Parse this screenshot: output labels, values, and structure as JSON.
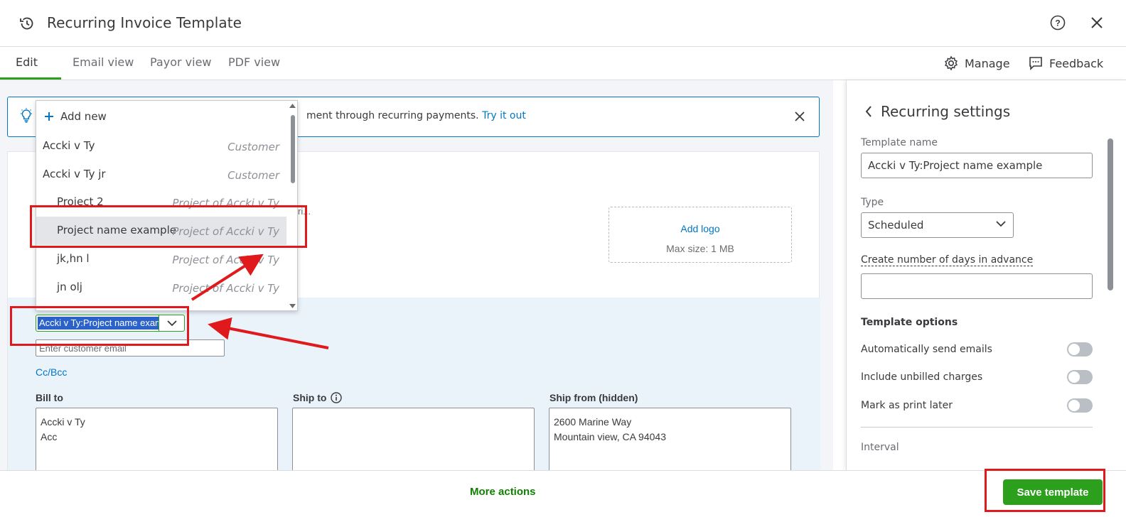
{
  "window": {
    "title": "Recurring Invoice Template"
  },
  "tabs": [
    {
      "label": "Edit",
      "active": true
    },
    {
      "label": "Email view",
      "active": false
    },
    {
      "label": "Payor view",
      "active": false
    },
    {
      "label": "PDF view",
      "active": false
    }
  ],
  "header_actions": {
    "manage": "Manage",
    "feedback": "Feedback"
  },
  "banner": {
    "text": "ment through recurring payments.",
    "link": "Try it out"
  },
  "logo": {
    "add": "Add logo",
    "max_size": "Max size: 1 MB"
  },
  "partial_text": "ri...",
  "customer": {
    "selected": "Accki v Ty:Project name example",
    "email_placeholder": "Enter customer email",
    "cc_bcc": "Cc/Bcc"
  },
  "dropdown": {
    "add_new": "Add new",
    "items": [
      {
        "name": "Accki v Ty",
        "type": "Customer",
        "indent": false,
        "selected": false
      },
      {
        "name": "Accki v Ty jr",
        "type": "Customer",
        "indent": false,
        "selected": false
      },
      {
        "name": "Project 2",
        "type": "Project of Accki v Ty",
        "indent": true,
        "selected": false
      },
      {
        "name": "Project name example",
        "type": "Project of Accki v Ty",
        "indent": true,
        "selected": true
      },
      {
        "name": "jk,hn l",
        "type": "Project of Accki v Ty",
        "indent": true,
        "selected": false
      },
      {
        "name": "jn olj",
        "type": "Project of Accki v Ty",
        "indent": true,
        "selected": false
      }
    ]
  },
  "addresses": {
    "bill_to": {
      "label": "Bill to",
      "value": "Accki v Ty\nAcc"
    },
    "ship_to": {
      "label": "Ship to",
      "value": ""
    },
    "ship_from": {
      "label": "Ship from (hidden)",
      "value": "2600 Marine Way\nMountain view, CA 94043"
    }
  },
  "recurring": {
    "title": "Recurring settings",
    "template_name_label": "Template name",
    "template_name": "Accki v Ty:Project name example",
    "type_label": "Type",
    "type_value": "Scheduled",
    "days_advance_label": "Create number of days in advance",
    "days_advance_value": "",
    "options_label": "Template options",
    "options": [
      {
        "label": "Automatically send emails",
        "on": false
      },
      {
        "label": "Include unbilled charges",
        "on": false
      },
      {
        "label": "Mark as print later",
        "on": false
      }
    ],
    "interval_label": "Interval"
  },
  "footer": {
    "more_actions": "More actions",
    "save": "Save template"
  },
  "colors": {
    "brand_green": "#2ca01c",
    "link_blue": "#0077c5",
    "annotation_red": "#e0191c",
    "highlight_blue": "#2a62c9"
  }
}
